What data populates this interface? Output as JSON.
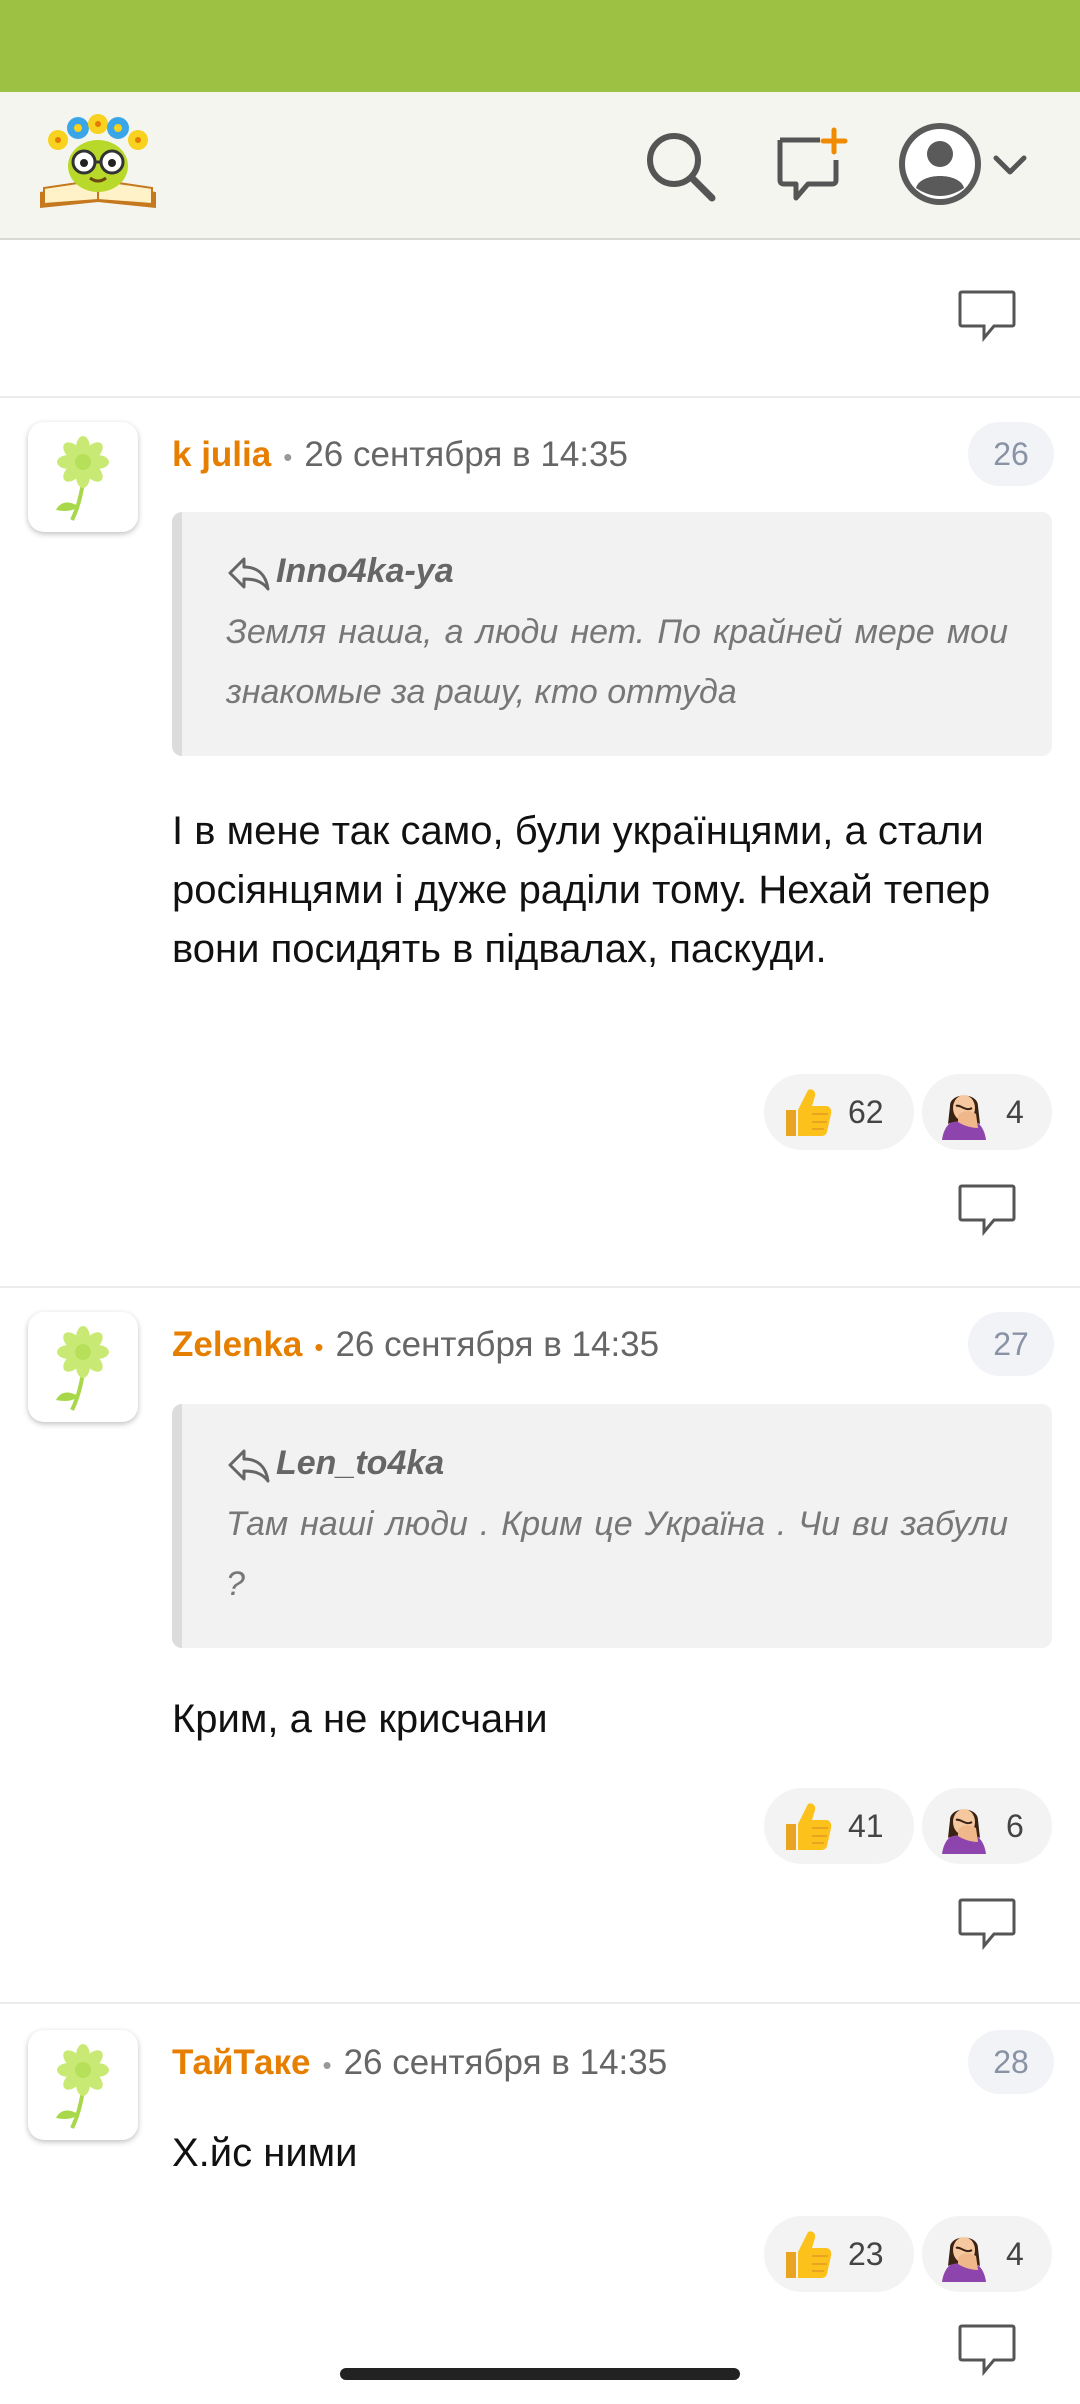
{
  "header": {
    "logo_icon": "book-with-flowers-logo-icon",
    "search_icon": "search-icon",
    "new_post_icon": "new-message-icon",
    "profile_icon": "user-avatar-icon",
    "menu_icon": "chevron-down-icon"
  },
  "colors": {
    "status_bar": "#9dc243",
    "author": "#e67e00",
    "badge_text": "#8a93a6"
  },
  "comments": [
    {
      "author": "k julia",
      "date": "26 сентября в 14:35",
      "number": "26",
      "quote": {
        "author": "Inno4ka-ya",
        "text": "Земля наша, а люди нет. По крайней мере мои знакомые за рашу, кто оттуда"
      },
      "text": "І в мене так само, були українцями, а стали росіянцями і дуже раділи тому. Нехай тепер вони посидять в підвалах, паскуди.",
      "reactions": [
        {
          "icon": "thumbs-up-icon",
          "count": "62"
        },
        {
          "icon": "facepalm-icon",
          "count": "4"
        }
      ]
    },
    {
      "author": "Zelenka",
      "date": "26 сентября в 14:35",
      "number": "27",
      "quote": {
        "author": "Len_to4ka",
        "text": "Там наші люди . Крим це Україна . Чи ви забули ?"
      },
      "text": "Крим, а не крисчани",
      "reactions": [
        {
          "icon": "thumbs-up-icon",
          "count": "41"
        },
        {
          "icon": "facepalm-icon",
          "count": "6"
        }
      ]
    },
    {
      "author": "ТайТаке",
      "date": "26 сентября в 14:35",
      "number": "28",
      "text": "Х.йс ними",
      "reactions": [
        {
          "icon": "thumbs-up-icon",
          "count": "23"
        },
        {
          "icon": "facepalm-icon",
          "count": "4"
        }
      ]
    }
  ]
}
